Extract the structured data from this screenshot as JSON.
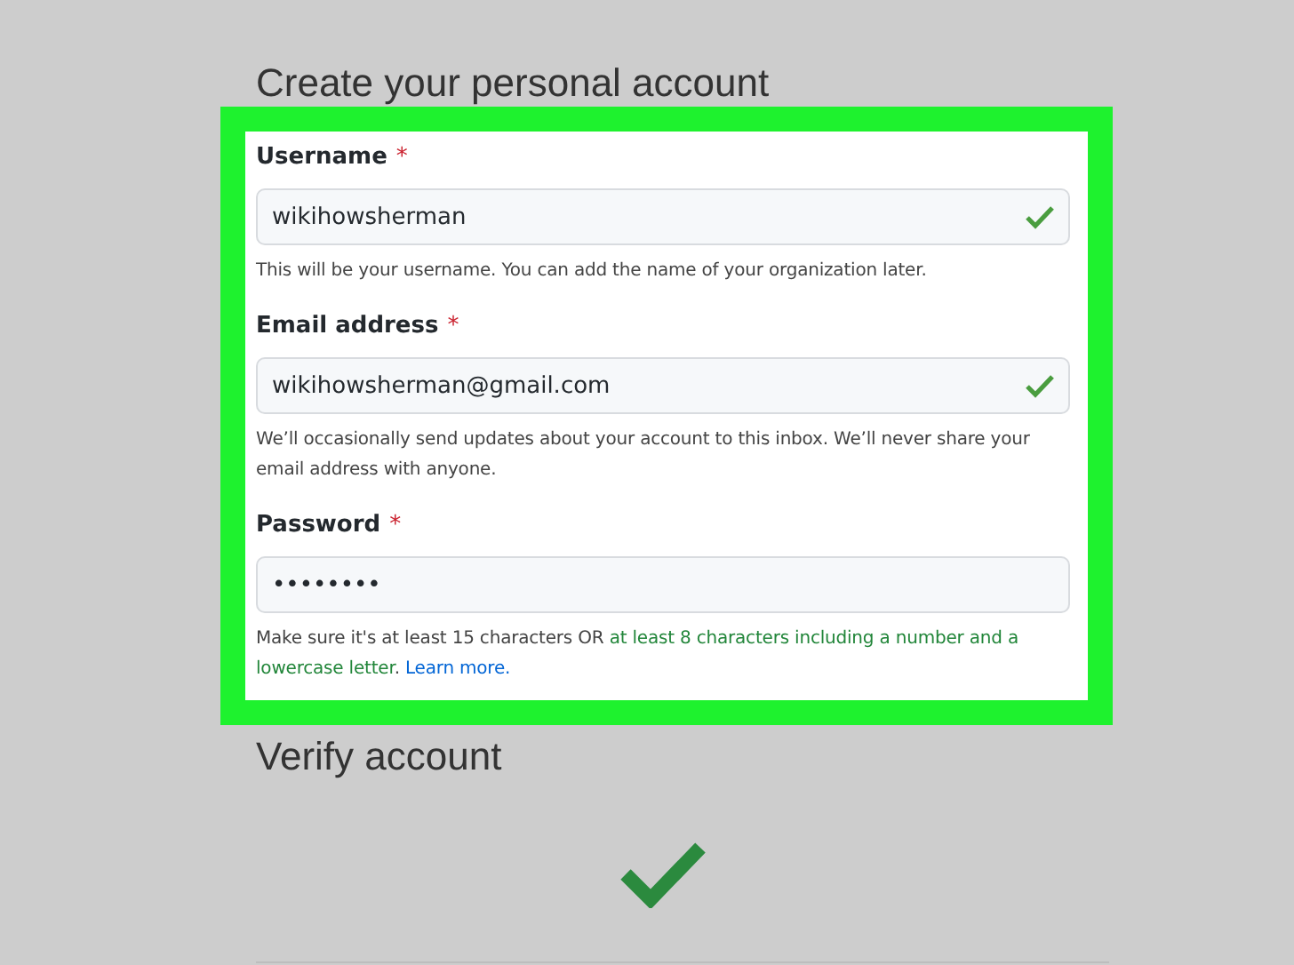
{
  "heading": "Create your personal account",
  "fields": [
    {
      "label": "Username",
      "required": "*",
      "value": "wikihowsherman",
      "valid": true,
      "hint": [
        {
          "kind": "plain",
          "text": "This will be your username. You can add the name of your organization later."
        }
      ]
    },
    {
      "label": "Email address",
      "required": "*",
      "value": "wikihowsherman@gmail.com",
      "valid": true,
      "hint": [
        {
          "kind": "plain",
          "text": "We’ll occasionally send updates about your account to this inbox. We’ll never share your email address with anyone."
        }
      ]
    },
    {
      "label": "Password",
      "required": "*",
      "value": "••••••••",
      "valid": false,
      "hint": [
        {
          "kind": "plain",
          "text": "Make sure it's at least 15 characters OR "
        },
        {
          "kind": "met",
          "text": "at least 8 characters including a number and a lowercase letter"
        },
        {
          "kind": "plain",
          "text": ". "
        },
        {
          "kind": "link",
          "text": "Learn more."
        }
      ]
    }
  ],
  "verify": {
    "heading": "Verify account",
    "verified": true
  }
}
